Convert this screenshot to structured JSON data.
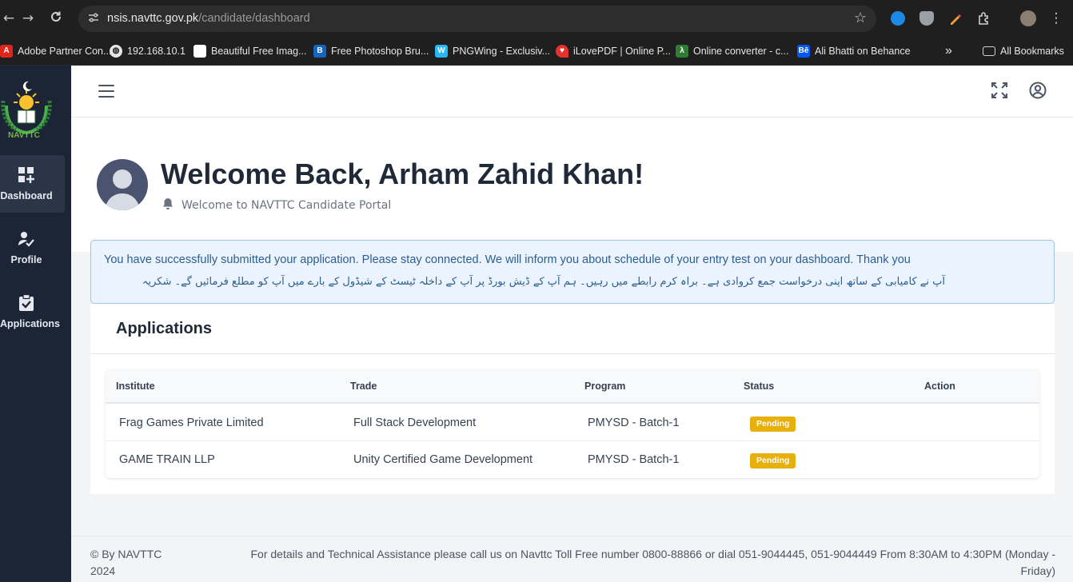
{
  "browser": {
    "url_domain": "nsis.navttc.gov.pk",
    "url_path": "/candidate/dashboard",
    "bookmarks": [
      {
        "label": "Adobe Partner Con...",
        "icon": "adobe-icon"
      },
      {
        "label": "192.168.10.1",
        "icon": "globe-icon"
      },
      {
        "label": "Beautiful Free Imag...",
        "icon": "unsplash-icon"
      },
      {
        "label": "Free Photoshop Bru...",
        "icon": "brusheezy-icon"
      },
      {
        "label": "PNGWing - Exclusiv...",
        "icon": "pngwing-icon"
      },
      {
        "label": "iLovePDF | Online P...",
        "icon": "ilovepdf-icon"
      },
      {
        "label": "Online converter - c...",
        "icon": "converter-icon"
      },
      {
        "label": "Ali Bhatti on Behance",
        "icon": "behance-icon"
      }
    ],
    "overflow_label": "»",
    "all_bookmarks_label": "All Bookmarks"
  },
  "sidebar": {
    "logo_text": "NAVTTC",
    "items": [
      {
        "label": "Dashboard",
        "icon": "dashboard-grid-icon",
        "active": true
      },
      {
        "label": "Profile",
        "icon": "user-check-icon",
        "active": false
      },
      {
        "label": "Applications",
        "icon": "clipboard-check-icon",
        "active": false
      }
    ]
  },
  "hero": {
    "greeting": "Welcome Back, Arham Zahid Khan!",
    "subtitle": "Welcome to NAVTTC Candidate Portal"
  },
  "alert": {
    "english": "You have successfully submitted your application. Please stay connected. We will inform you about schedule of your entry test on your dashboard. Thank you",
    "urdu": "آپ نے کامیابی کے ساتھ اپنی درخواست جمع کروادی ہے۔ براہ کرم رابطے میں رہیں۔ ہم آپ کے ڈیش بورڈ پر آپ کے داخلہ ٹیسٹ کے شیڈول کے بارے میں آپ کو مطلع فرمائیں گے۔ شکریہ"
  },
  "applications": {
    "title": "Applications",
    "columns": [
      "Institute",
      "Trade",
      "Program",
      "Status",
      "Action"
    ],
    "rows": [
      {
        "institute": "Frag Games Private Limited",
        "trade": "Full Stack Development",
        "program": "PMYSD - Batch-1",
        "status": "Pending"
      },
      {
        "institute": "GAME TRAIN LLP",
        "trade": "Unity Certified Game Development",
        "program": "PMYSD - Batch-1",
        "status": "Pending"
      }
    ]
  },
  "footer": {
    "copyright": "© By NAVTTC 2024",
    "info": "For details and Technical Assistance please call us on Navttc Toll Free number 0800-88866 or dial 051-9044445, 051-9044449 From 8:30AM to 4:30PM (Monday - Friday)"
  },
  "colors": {
    "sidebar_bg": "#1b2535",
    "alert_bg": "#eaf3fe",
    "alert_text": "#2c5f8f",
    "pending_badge": "#e8b00c"
  }
}
